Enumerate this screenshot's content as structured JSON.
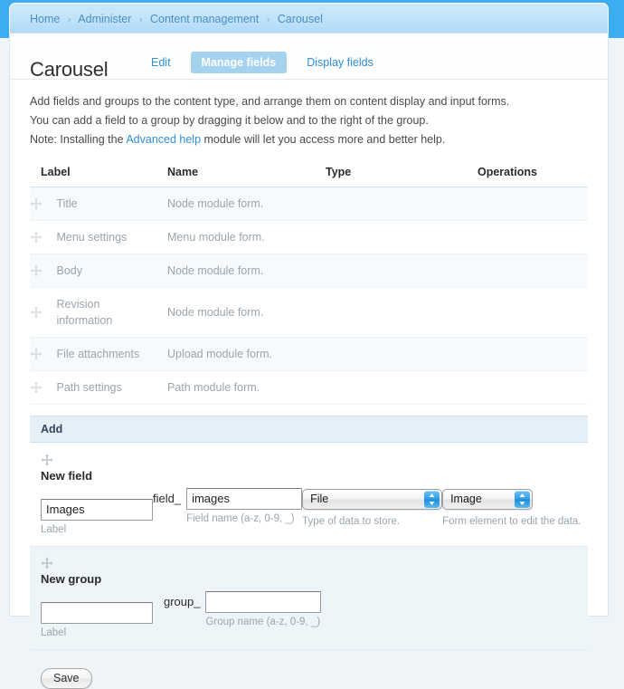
{
  "breadcrumb": {
    "separator": "›",
    "items": [
      "Home",
      "Administer",
      "Content management",
      "Carousel"
    ]
  },
  "header": {
    "title": "Carousel",
    "tabs": [
      {
        "label": "Edit",
        "active": false
      },
      {
        "label": "Manage fields",
        "active": true
      },
      {
        "label": "Display fields",
        "active": false
      }
    ]
  },
  "help": {
    "line1": "Add fields and groups to the content type, and arrange them on content display and input forms.",
    "line2": "You can add a field to a group by dragging it below and to the right of the group.",
    "line3_pre": "Note: Installing the ",
    "line3_link": "Advanced help",
    "line3_post": " module will let you access more and better help."
  },
  "table": {
    "headers": [
      "Label",
      "Name",
      "Type",
      "Operations"
    ],
    "rows": [
      {
        "label": "Title",
        "name": "Node module form.",
        "type": "",
        "operations": ""
      },
      {
        "label": "Menu settings",
        "name": "Menu module form.",
        "type": "",
        "operations": ""
      },
      {
        "label": "Body",
        "name": "Node module form.",
        "type": "",
        "operations": ""
      },
      {
        "label": "Revision information",
        "name": "Node module form.",
        "type": "",
        "operations": ""
      },
      {
        "label": "File attachments",
        "name": "Upload module form.",
        "type": "",
        "operations": ""
      },
      {
        "label": "Path settings",
        "name": "Path module form.",
        "type": "",
        "operations": ""
      }
    ]
  },
  "add_section": {
    "header": "Add",
    "new_field": {
      "heading": "New field",
      "label_value": "Images",
      "label_placeholder": "",
      "label_hint": "Label",
      "name_prefix": "field_",
      "name_value": "images",
      "name_placeholder": "",
      "name_hint": "Field name (a-z, 0-9, _)",
      "type_selected": "File",
      "type_hint": "Type of data to store.",
      "widget_selected": "Image",
      "widget_hint": "Form element to edit the data."
    },
    "new_group": {
      "heading": "New group",
      "label_value": "",
      "label_placeholder": "",
      "label_hint": "Label",
      "name_prefix": "group_",
      "name_value": "",
      "name_placeholder": "",
      "name_hint": "Group name (a-z, 0-9, _)"
    }
  },
  "footer": {
    "save_label": "Save"
  },
  "icons": {
    "drag_handle": "move-cross-icon",
    "select_arrows": "up-down-arrows-icon"
  },
  "colors": {
    "page_blue": "#3cadf0",
    "breadcrumb_link": "#4a8ec2",
    "tab_link": "#2f8fd4",
    "active_tab_bg": "#a5d3ef",
    "row_odd": "#f7fafc",
    "add_header_bg": "#e4eff8",
    "new_group_bg": "#eef5f9"
  }
}
